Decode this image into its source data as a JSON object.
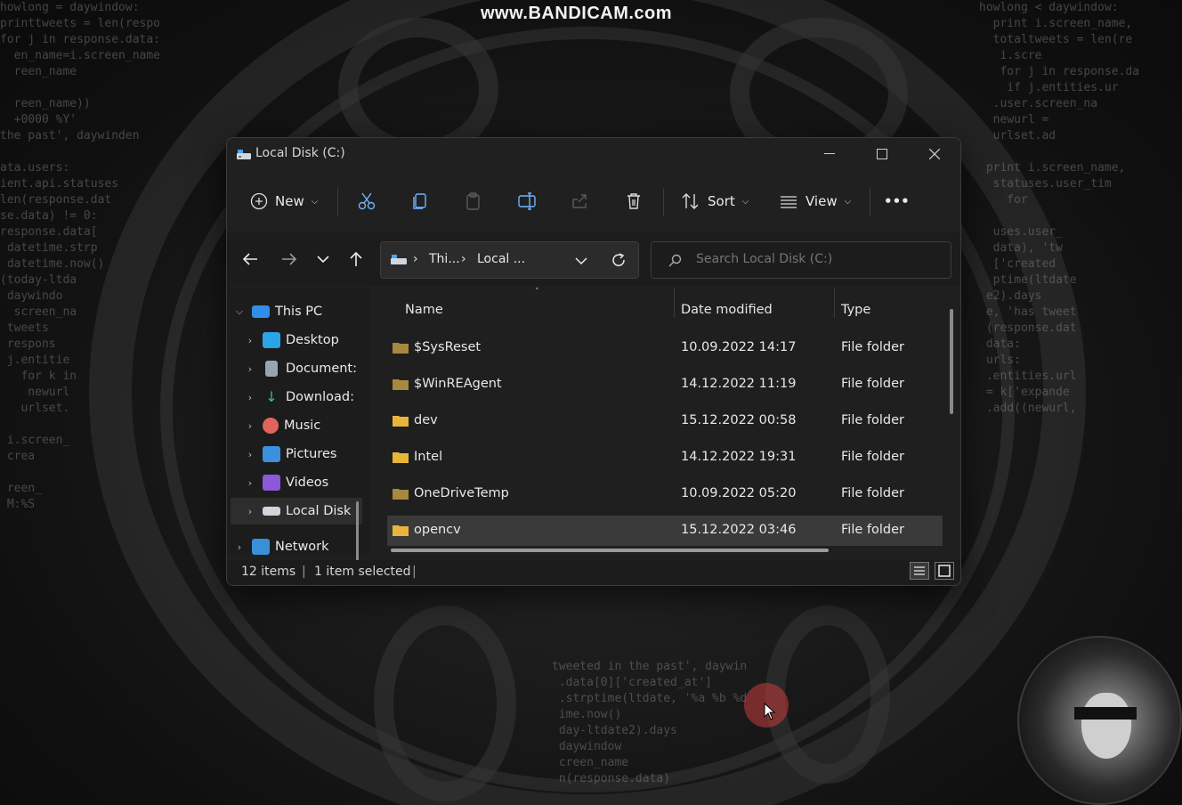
{
  "watermark": "www.BANDICAM.com",
  "window": {
    "title": "Local Disk (C:)"
  },
  "toolbar": {
    "new_label": "New",
    "sort_label": "Sort",
    "view_label": "View",
    "more_label": "•••"
  },
  "address": {
    "crumb_1": "Thi...",
    "crumb_2": "Local ..."
  },
  "search": {
    "placeholder": "Search Local Disk (C:)"
  },
  "sidebar": {
    "items": [
      {
        "label": "This PC"
      },
      {
        "label": "Desktop"
      },
      {
        "label": "Document:"
      },
      {
        "label": "Download:"
      },
      {
        "label": "Music"
      },
      {
        "label": "Pictures"
      },
      {
        "label": "Videos"
      },
      {
        "label": "Local Disk"
      },
      {
        "label": "Network"
      }
    ]
  },
  "columns": {
    "name": "Name",
    "date": "Date modified",
    "type": "Type"
  },
  "files": [
    {
      "name": "$SysReset",
      "date": "10.09.2022 14:17",
      "type": "File folder"
    },
    {
      "name": "$WinREAgent",
      "date": "14.12.2022 11:19",
      "type": "File folder"
    },
    {
      "name": "dev",
      "date": "15.12.2022 00:58",
      "type": "File folder"
    },
    {
      "name": "Intel",
      "date": "14.12.2022 19:31",
      "type": "File folder"
    },
    {
      "name": "OneDriveTemp",
      "date": "10.09.2022 05:20",
      "type": "File folder"
    },
    {
      "name": "opencv",
      "date": "15.12.2022 03:46",
      "type": "File folder"
    }
  ],
  "status": {
    "count": "12 items",
    "selected": "1 item selected"
  },
  "colors": {
    "folder_yellow": "#e8b53a",
    "folder_dim": "#a8873e",
    "accent_blue": "#4aa3ff"
  }
}
